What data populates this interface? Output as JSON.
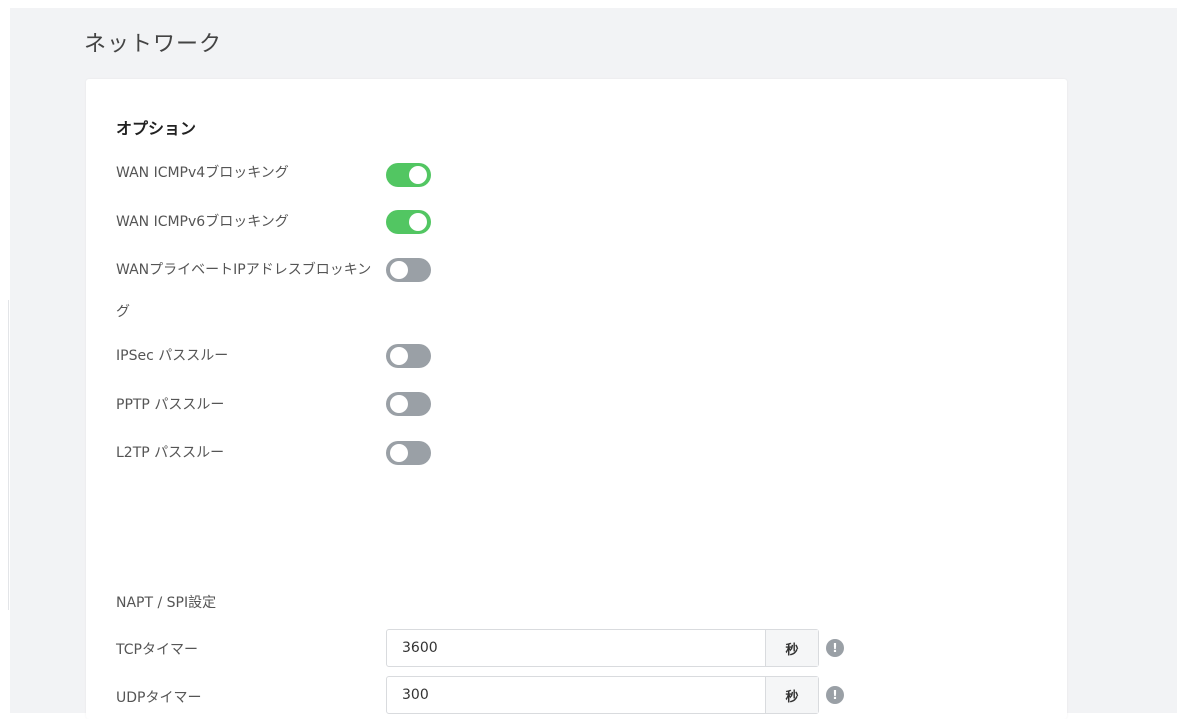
{
  "page": {
    "title": "ネットワーク"
  },
  "options": {
    "section_title": "オプション",
    "items": [
      {
        "label": "WAN ICMPv4ブロッキング",
        "state": "on"
      },
      {
        "label": "WAN ICMPv6ブロッキング",
        "state": "on"
      },
      {
        "label": "WANプライベートIPアドレスブロッキング",
        "state": "off"
      },
      {
        "label": "IPSec パススルー",
        "state": "off"
      },
      {
        "label": "PPTP パススルー",
        "state": "off"
      },
      {
        "label": "L2TP パススルー",
        "state": "off"
      }
    ]
  },
  "napt": {
    "section_title": "NAPT / SPI設定",
    "fields": [
      {
        "label": "TCPタイマー",
        "value": "3600",
        "unit": "秒"
      },
      {
        "label": "UDPタイマー",
        "value": "300",
        "unit": "秒"
      }
    ]
  },
  "colors": {
    "toggle_on": "#52c662",
    "toggle_off": "#9aa0a6",
    "info_icon": "#9aa0a6"
  }
}
